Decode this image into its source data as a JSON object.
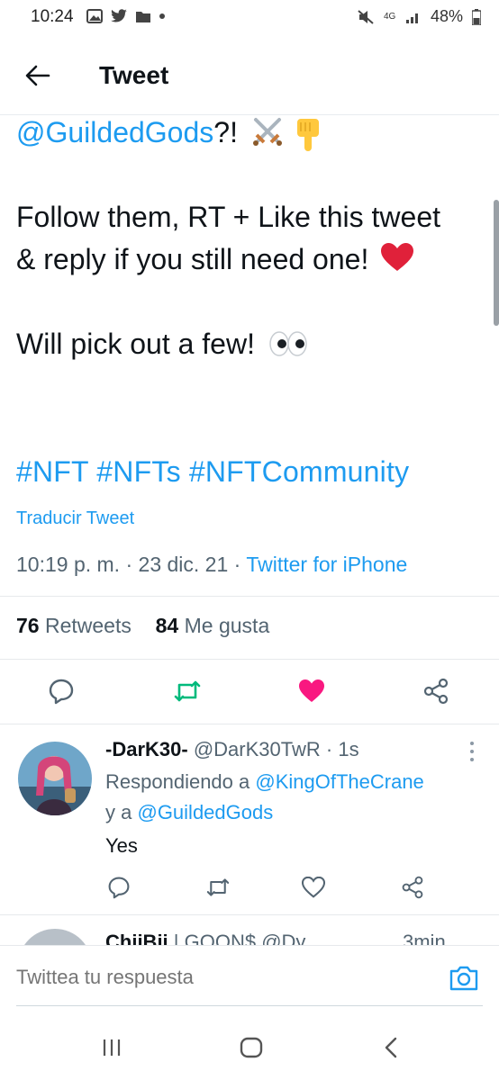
{
  "status_bar": {
    "time": "10:24",
    "network": "4G",
    "battery": "48%"
  },
  "header": {
    "title": "Tweet"
  },
  "tweet": {
    "line1_mention": "@GuildedGods",
    "line1_suffix": "?!",
    "line1_emojis": [
      "crossed-swords",
      "pointing-down"
    ],
    "line2": "Follow them, RT + Like this tweet & reply if you still need one!",
    "line2_emoji": "red-heart",
    "line3": "Will pick out a few!",
    "line3_emoji": "eyes",
    "hashtags": "#NFT #NFTs #NFTCommunity",
    "translate_label": "Traducir Tweet",
    "time": "10:19 p. m.",
    "separator": "·",
    "date": "23 dic. 21",
    "source": "Twitter for iPhone",
    "retweets_count": "76",
    "retweets_label": "Retweets",
    "likes_count": "84",
    "likes_label": "Me gusta",
    "colors": {
      "link": "#1d9bf0",
      "retweet": "#00ba7c",
      "like": "#f91880"
    }
  },
  "reply": {
    "name": "-DarK30-",
    "handle": "@DarK30TwR",
    "time": "· 1s",
    "replying_prefix": "Respondiendo a",
    "replying_to_1": "@KingOfTheCrane",
    "replying_and": "y a",
    "replying_to_2": "@GuildedGods",
    "text": "Yes"
  },
  "next_reply": {
    "name": "ChiiBii",
    "rest": "| GOON$ @Dy...",
    "time": "3min"
  },
  "compose": {
    "placeholder": "Twittea tu respuesta"
  }
}
